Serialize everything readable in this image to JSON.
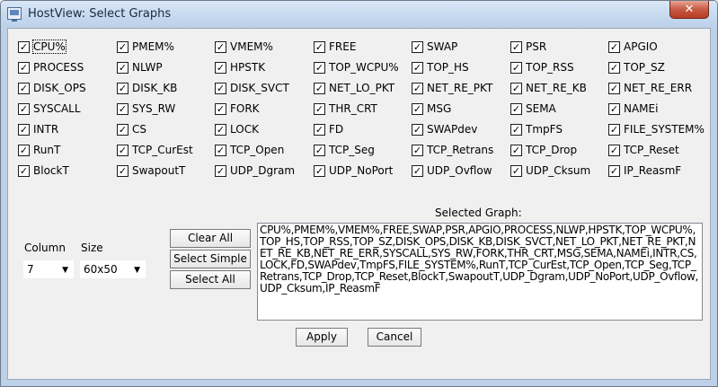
{
  "window": {
    "title": "HostView: Select Graphs",
    "close_label": "✕"
  },
  "checkboxes": [
    {
      "label": "CPU%",
      "checked": true
    },
    {
      "label": "PMEM%",
      "checked": true
    },
    {
      "label": "VMEM%",
      "checked": true
    },
    {
      "label": "FREE",
      "checked": true
    },
    {
      "label": "SWAP",
      "checked": true
    },
    {
      "label": "PSR",
      "checked": true
    },
    {
      "label": "APGIO",
      "checked": true
    },
    {
      "label": "PROCESS",
      "checked": true
    },
    {
      "label": "NLWP",
      "checked": true
    },
    {
      "label": "HPSTK",
      "checked": true
    },
    {
      "label": "TOP_WCPU%",
      "checked": true
    },
    {
      "label": "TOP_HS",
      "checked": true
    },
    {
      "label": "TOP_RSS",
      "checked": true
    },
    {
      "label": "TOP_SZ",
      "checked": true
    },
    {
      "label": "DISK_OPS",
      "checked": true
    },
    {
      "label": "DISK_KB",
      "checked": true
    },
    {
      "label": "DISK_SVCT",
      "checked": true
    },
    {
      "label": "NET_LO_PKT",
      "checked": true
    },
    {
      "label": "NET_RE_PKT",
      "checked": true
    },
    {
      "label": "NET_RE_KB",
      "checked": true
    },
    {
      "label": "NET_RE_ERR",
      "checked": true
    },
    {
      "label": "SYSCALL",
      "checked": true
    },
    {
      "label": "SYS_RW",
      "checked": true
    },
    {
      "label": "FORK",
      "checked": true
    },
    {
      "label": "THR_CRT",
      "checked": true
    },
    {
      "label": "MSG",
      "checked": true
    },
    {
      "label": "SEMA",
      "checked": true
    },
    {
      "label": "NAMEi",
      "checked": true
    },
    {
      "label": "INTR",
      "checked": true
    },
    {
      "label": "CS",
      "checked": true
    },
    {
      "label": "LOCK",
      "checked": true
    },
    {
      "label": "FD",
      "checked": true
    },
    {
      "label": "SWAPdev",
      "checked": true
    },
    {
      "label": "TmpFS",
      "checked": true
    },
    {
      "label": "FILE_SYSTEM%",
      "checked": true
    },
    {
      "label": "RunT",
      "checked": true
    },
    {
      "label": "TCP_CurEst",
      "checked": true
    },
    {
      "label": "TCP_Open",
      "checked": true
    },
    {
      "label": "TCP_Seg",
      "checked": true
    },
    {
      "label": "TCP_Retrans",
      "checked": true
    },
    {
      "label": "TCP_Drop",
      "checked": true
    },
    {
      "label": "TCP_Reset",
      "checked": true
    },
    {
      "label": "BlockT",
      "checked": true
    },
    {
      "label": "SwapoutT",
      "checked": true
    },
    {
      "label": "UDP_Dgram",
      "checked": true
    },
    {
      "label": "UDP_NoPort",
      "checked": true
    },
    {
      "label": "UDP_Ovflow",
      "checked": true
    },
    {
      "label": "UDP_Cksum",
      "checked": true
    },
    {
      "label": "IP_ReasmF",
      "checked": true
    }
  ],
  "check_mark": "✓",
  "column": {
    "label": "Column",
    "value": "7",
    "arrow": "▼"
  },
  "size": {
    "label": "Size",
    "value": "60x50",
    "arrow": "▼"
  },
  "buttons": {
    "clear_all": "Clear All",
    "select_simple": "Select Simple",
    "select_all": "Select All",
    "apply": "Apply",
    "cancel": "Cancel"
  },
  "selected_graph": {
    "label": "Selected Graph:",
    "value": "CPU%,PMEM%,VMEM%,FREE,SWAP,PSR,APGIO,PROCESS,NLWP,HPSTK,TOP_WCPU%,TOP_HS,TOP_RSS,TOP_SZ,DISK_OPS,DISK_KB,DISK_SVCT,NET_LO_PKT,NET_RE_PKT,NET_RE_KB,NET_RE_ERR,SYSCALL,SYS_RW,FORK,THR_CRT,MSG,SEMA,NAMEi,INTR,CS,LOCK,FD,SWAPdev,TmpFS,FILE_SYSTEM%,RunT,TCP_CurEst,TCP_Open,TCP_Seg,TCP_Retrans,TCP_Drop,TCP_Reset,BlockT,SwapoutT,UDP_Dgram,UDP_NoPort,UDP_Ovflow,UDP_Cksum,IP_ReasmF"
  }
}
